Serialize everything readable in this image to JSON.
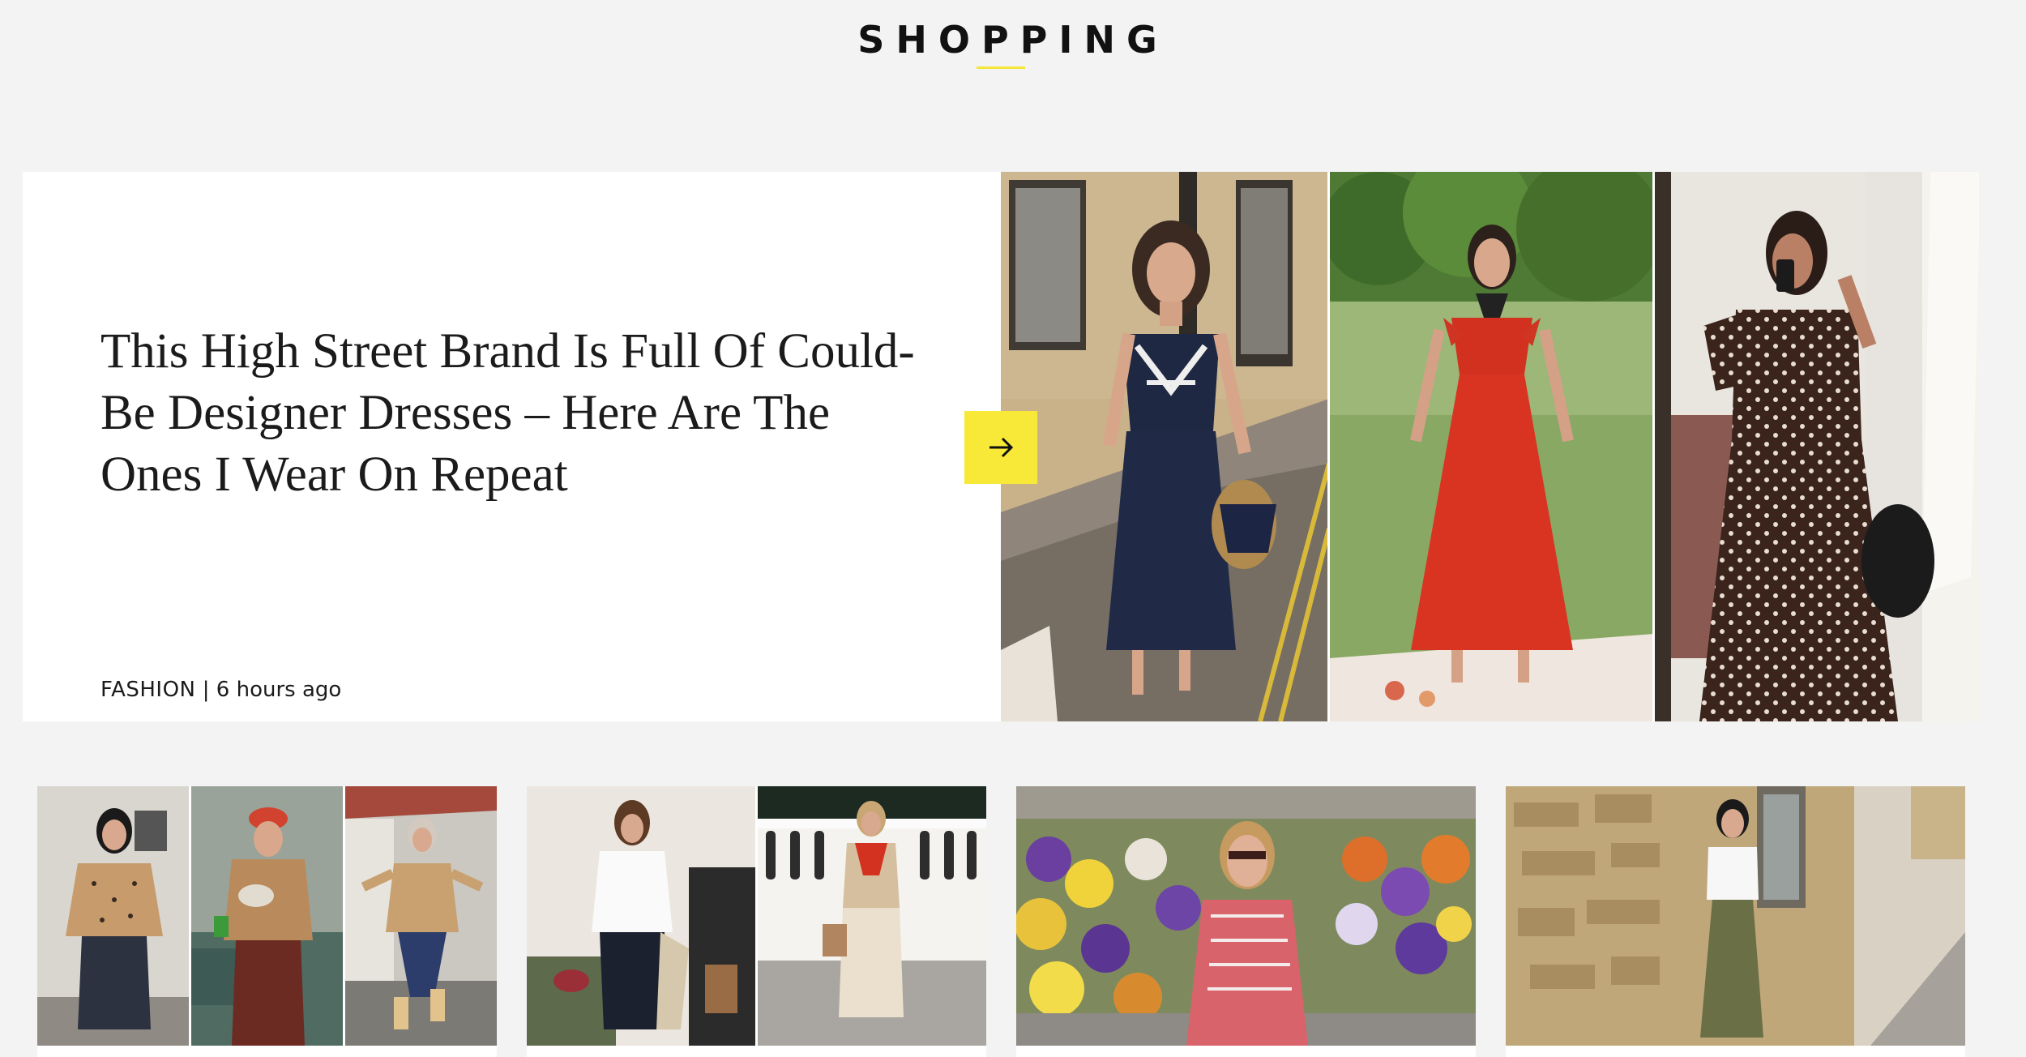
{
  "section": {
    "title": "SHOPPING"
  },
  "featured": {
    "headline": "This High Street Brand Is Full Of Could-Be Designer Dresses – Here Are The Ones I Wear On Repeat",
    "category": "FASHION",
    "separator": "|",
    "time": "6 hours ago",
    "next_icon": "arrow-right-icon",
    "accent_color": "#f8e938",
    "photos": [
      {
        "subject": "woman-in-navy-dress"
      },
      {
        "subject": "woman-in-red-dress"
      },
      {
        "subject": "woman-in-polka-dot-dress"
      }
    ]
  },
  "cards": [
    {
      "tiles": 3
    },
    {
      "tiles": 2
    },
    {
      "tiles": 1
    },
    {
      "tiles": 1
    }
  ],
  "colors": {
    "background": "#f3f3f3",
    "card": "#ffffff",
    "accent": "#f5e63a",
    "text": "#1b1b1b"
  }
}
